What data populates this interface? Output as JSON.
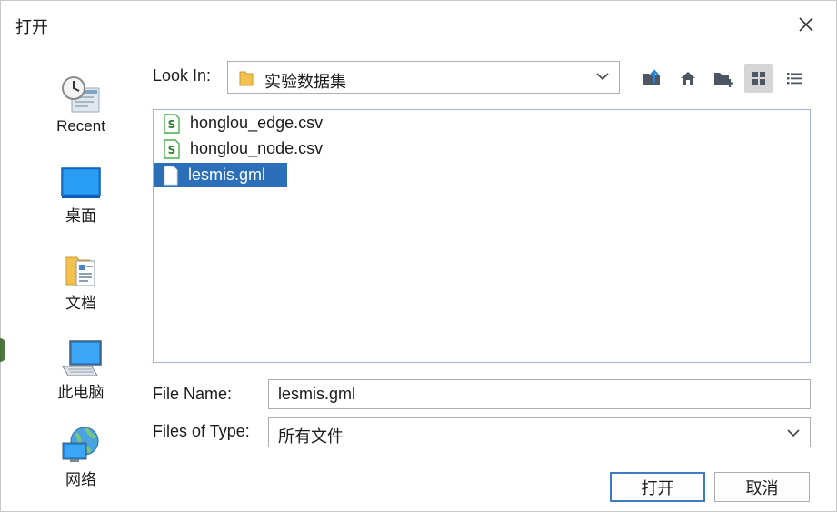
{
  "dialog": {
    "title": "打开",
    "close_icon": "close-icon"
  },
  "sidebar": {
    "items": [
      {
        "label": "Recent",
        "icon": "recent-icon"
      },
      {
        "label": "桌面",
        "icon": "desktop-icon"
      },
      {
        "label": "文档",
        "icon": "documents-icon"
      },
      {
        "label": "此电脑",
        "icon": "computer-icon"
      },
      {
        "label": "网络",
        "icon": "network-icon"
      }
    ]
  },
  "look_in": {
    "label": "Look In:",
    "value": "实验数据集",
    "icon": "folder-icon"
  },
  "toolbar": {
    "buttons": [
      {
        "name": "up-one-level",
        "icon": "up-folder-icon"
      },
      {
        "name": "home",
        "icon": "home-icon"
      },
      {
        "name": "new-folder",
        "icon": "new-folder-icon"
      },
      {
        "name": "list-view",
        "icon": "grid-icon",
        "active": true
      },
      {
        "name": "details-view",
        "icon": "details-icon"
      }
    ]
  },
  "files": [
    {
      "name": "honglou_edge.csv",
      "icon": "csv-icon",
      "selected": false
    },
    {
      "name": "honglou_node.csv",
      "icon": "csv-icon",
      "selected": false
    },
    {
      "name": "lesmis.gml",
      "icon": "file-icon",
      "selected": true
    }
  ],
  "file_name": {
    "label": "File Name:",
    "value": "lesmis.gml"
  },
  "file_type": {
    "label": "Files of Type:",
    "value": "所有文件"
  },
  "buttons": {
    "open": "打开",
    "cancel": "取消"
  },
  "colors": {
    "selection": "#2a6fb8",
    "primary_border": "#3d7bc4",
    "toolbar_active": "#d6d6d6"
  }
}
